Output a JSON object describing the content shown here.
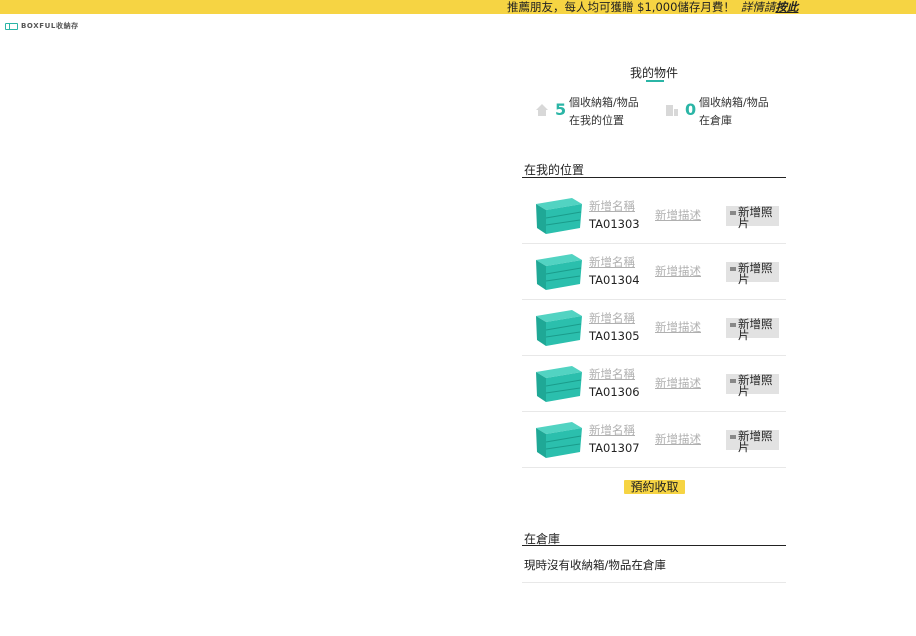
{
  "banner": {
    "message": "推薦朋友，每人均可獲贈 $1,000儲存月費！",
    "detail_text": "詳情請",
    "link_text": "按此"
  },
  "logo": {
    "text": "BOXFUL",
    "subtext": "收納存"
  },
  "tabs": {
    "active_label": "我的物件"
  },
  "summary": {
    "at_home": {
      "count": "5",
      "line1": "個收納箱/物品",
      "line2": "在我的位置"
    },
    "in_warehouse": {
      "count": "0",
      "line1": "個收納箱/物品",
      "line2": "在倉庫"
    }
  },
  "sections": {
    "my_location_title": "在我的位置",
    "warehouse_title": "在倉庫",
    "warehouse_empty": "現時沒有收納箱/物品在倉庫"
  },
  "items": [
    {
      "name_placeholder": "新增名稱",
      "code": "TA01303",
      "description_placeholder": "新增描述",
      "photo_label": "新增照片"
    },
    {
      "name_placeholder": "新增名稱",
      "code": "TA01304",
      "description_placeholder": "新增描述",
      "photo_label": "新增照片"
    },
    {
      "name_placeholder": "新增名稱",
      "code": "TA01305",
      "description_placeholder": "新增描述",
      "photo_label": "新增照片"
    },
    {
      "name_placeholder": "新增名稱",
      "code": "TA01306",
      "description_placeholder": "新增描述",
      "photo_label": "新增照片"
    },
    {
      "name_placeholder": "新增名稱",
      "code": "TA01307",
      "description_placeholder": "新增描述",
      "photo_label": "新增照片"
    }
  ],
  "actions": {
    "schedule_pickup": "預約收取"
  },
  "colors": {
    "banner_bg": "#f6d443",
    "accent_teal": "#2bb5a6",
    "button_yellow": "#f6d443"
  }
}
